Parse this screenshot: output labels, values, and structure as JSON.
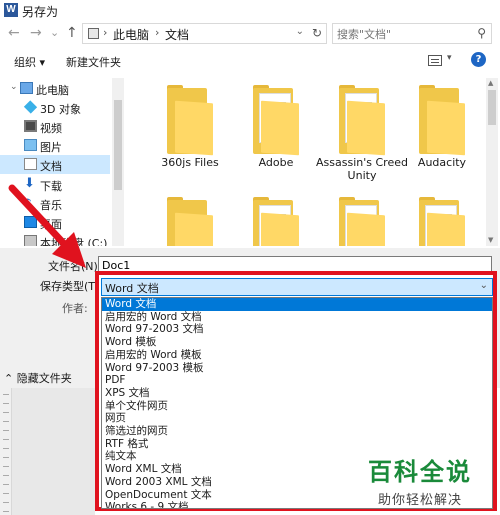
{
  "window": {
    "title": "另存为",
    "app_icon": "W"
  },
  "nav_buttons": [
    "←",
    "→",
    "⌄",
    "↑"
  ],
  "breadcrumb": {
    "items": [
      "此电脑",
      "文档"
    ],
    "separator": "›"
  },
  "search": {
    "placeholder": "搜索\"文档\""
  },
  "toolbar": {
    "organize": "组织 ▾",
    "new_folder": "新建文件夹",
    "help": "?"
  },
  "sidebar": {
    "items": [
      {
        "label": "此电脑",
        "icon": "pc-icon"
      },
      {
        "label": "3D 对象",
        "icon": "3d-objects-icon"
      },
      {
        "label": "视频",
        "icon": "video-icon"
      },
      {
        "label": "图片",
        "icon": "pictures-icon"
      },
      {
        "label": "文档",
        "icon": "documents-icon"
      },
      {
        "label": "下载",
        "icon": "downloads-icon"
      },
      {
        "label": "音乐",
        "icon": "music-icon"
      },
      {
        "label": "桌面",
        "icon": "desktop-icon"
      },
      {
        "label": "本地磁盘 (C:)",
        "icon": "disk-icon"
      }
    ]
  },
  "files": [
    {
      "name": "360js Files"
    },
    {
      "name": "Adobe"
    },
    {
      "name": "Assassin's Creed Unity"
    },
    {
      "name": "Audacity"
    }
  ],
  "form": {
    "filename_label": "文件名(N):",
    "filename_value": "Doc1",
    "savetype_label": "保存类型(T):",
    "author_label": "作者:",
    "savetype_selected": "Word 文档",
    "savetype_options": [
      "Word 文档",
      "启用宏的 Word 文档",
      "Word 97-2003 文档",
      "Word 模板",
      "启用宏的 Word 模板",
      "Word 97-2003 模板",
      "PDF",
      "XPS 文档",
      "单个文件网页",
      "网页",
      "筛选过的网页",
      "RTF 格式",
      "纯文本",
      "Word XML 文档",
      "Word 2003 XML 文档",
      "OpenDocument 文本",
      "Works 6 - 9 文档"
    ]
  },
  "hide_folders": "⌃ 隐藏文件夹",
  "watermark": {
    "title": "百科全说",
    "subtitle": "助你轻松解决"
  },
  "colors": {
    "highlight_border": "#e0121e",
    "selection": "#0078d7",
    "watermark_green": "#1a8a3a"
  }
}
